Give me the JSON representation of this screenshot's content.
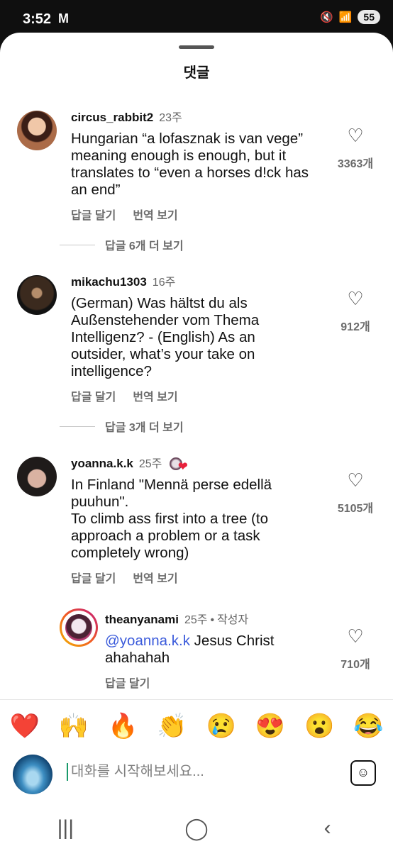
{
  "status_bar": {
    "time": "3:52",
    "mail_icon": "M",
    "battery": "55"
  },
  "sheet": {
    "title": "댓글"
  },
  "comments": [
    {
      "username": "circus_rabbit2",
      "time": "23주",
      "text": "Hungarian “a lofasznak is van vege”\nmeaning enough is enough, but it\ntranslates to “even a horses d!ck has\nan end”",
      "reply_label": "답글 달기",
      "translate_label": "번역 보기",
      "likes": "3363개",
      "more_replies": "답글 6개 더 보기"
    },
    {
      "username": "mikachu1303",
      "time": "16주",
      "text": "(German) Was hältst du als\nAußenstehender vom Thema\nIntelligenz? - (English) As an\noutsider, what’s your take on\nintelligence?",
      "reply_label": "답글 달기",
      "translate_label": "번역 보기",
      "likes": "912개",
      "more_replies": "답글 3개 더 보기"
    },
    {
      "username": "yoanna.k.k",
      "time": "25주",
      "text": "In Finland \"Mennä perse edellä\npuuhun\".\nTo climb ass first into a tree (to\napproach a problem or a task\ncompletely wrong)",
      "reply_label": "답글 달기",
      "translate_label": "번역 보기",
      "likes": "5105개"
    }
  ],
  "reply": {
    "username": "theanyanami",
    "time": "25주",
    "separator": "•",
    "author_label": "작성자",
    "mention": "@yoanna.k.k",
    "text": " Jesus Christ\nahahahah",
    "reply_label": "답글 달기",
    "likes": "710개"
  },
  "emoji_bar": [
    "❤️",
    "🙌",
    "🔥",
    "👏",
    "😢",
    "😍",
    "😮",
    "😂"
  ],
  "composer": {
    "placeholder": "대화를 시작해보세요..."
  },
  "nav": {
    "recents": "|||",
    "home": "◯",
    "back": "‹"
  }
}
